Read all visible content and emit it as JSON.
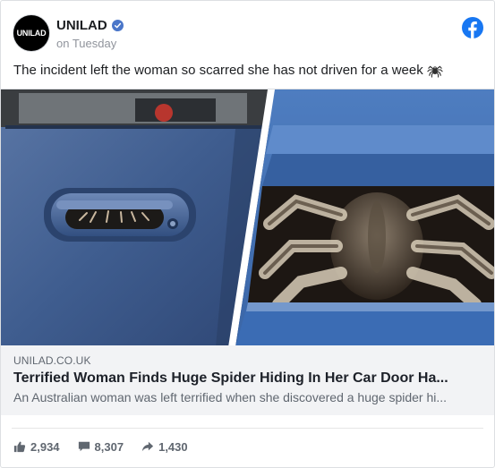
{
  "header": {
    "avatar_text": "UNILAD",
    "page_name": "UNILAD",
    "verified_icon": "verified-check-icon",
    "timestamp": "on Tuesday",
    "network_icon": "facebook-icon"
  },
  "post": {
    "text": "The incident left the woman so scarred she has not driven for a week",
    "emoji_icon": "spider-icon"
  },
  "image": {
    "left_panel": "car door handle photo",
    "right_panel": "spider close-up photo"
  },
  "link": {
    "domain": "UNILAD.CO.UK",
    "title": "Terrified Woman Finds Huge Spider Hiding In Her Car Door Ha...",
    "description": "An Australian woman was left terrified when she discovered a huge spider hi..."
  },
  "stats": {
    "likes": "2,934",
    "comments": "8,307",
    "shares": "1,430"
  },
  "colors": {
    "facebook_blue": "#1877f2",
    "link_bg": "#f2f3f5",
    "muted_text": "#606770",
    "car_blue": "#34548a"
  }
}
